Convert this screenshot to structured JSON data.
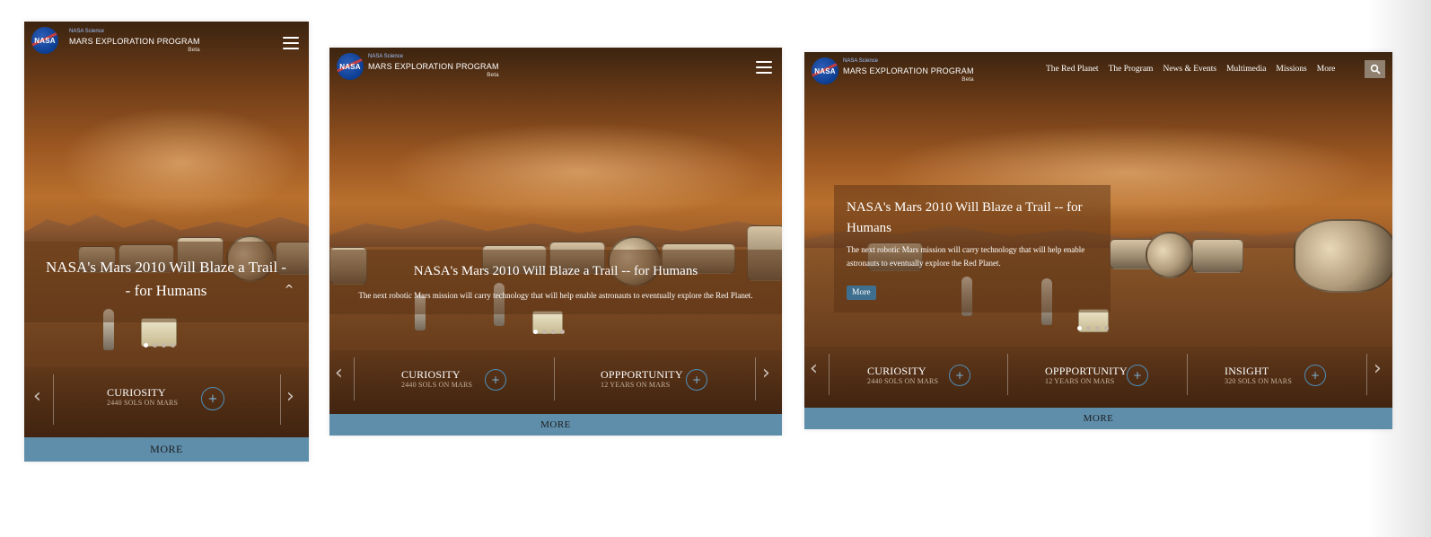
{
  "brand": {
    "agency": "NASA",
    "science": "NASA Science",
    "program": "MARS EXPLORATION PROGRAM",
    "beta": "Beta"
  },
  "nav": {
    "items": [
      "The Red Planet",
      "The Program",
      "News & Events",
      "Multimedia",
      "Missions",
      "More"
    ]
  },
  "hero": {
    "title": "NASA's Mars 2010 Will Blaze a Trail -- for Humans",
    "title_mobile_line1": "NASA's Mars 2010 Will Blaze a Trail -",
    "title_mobile_line2": "- for Humans",
    "title_desktop_line1": "NASA's Mars 2010 Will Blaze a Trail -- for",
    "title_desktop_line2": "Humans",
    "description": "The next robotic Mars mission will carry technology that will help enable astronauts to eventually explore the Red Planet.",
    "description_line1": "The next robotic Mars mission will carry technology that will help enable",
    "description_line2": "astronauts to eventually explore the Red Planet.",
    "more_label": "More",
    "slide_count": 4,
    "active_slide": 1
  },
  "missions": [
    {
      "name": "CURIOSITY",
      "sub": "2440 SOLS ON MARS"
    },
    {
      "name": "OPPPORTUNITY",
      "sub": "12 YEARS ON MARS"
    },
    {
      "name": "INSIGHT",
      "sub": "320 SOLS ON MARS"
    }
  ],
  "more_bar_label": "MORE",
  "icons": {
    "menu": "hamburger-icon",
    "search": "search-icon",
    "prev": "chevron-left-icon",
    "next": "chevron-right-icon",
    "expand": "plus-circle-icon",
    "collapse": "caret-up-icon"
  },
  "colors": {
    "more_bar": "#5f8eab",
    "more_button": "#3f6f8e",
    "plus_ring": "#4f8eb8",
    "nasa_blue": "#0b3d91"
  }
}
